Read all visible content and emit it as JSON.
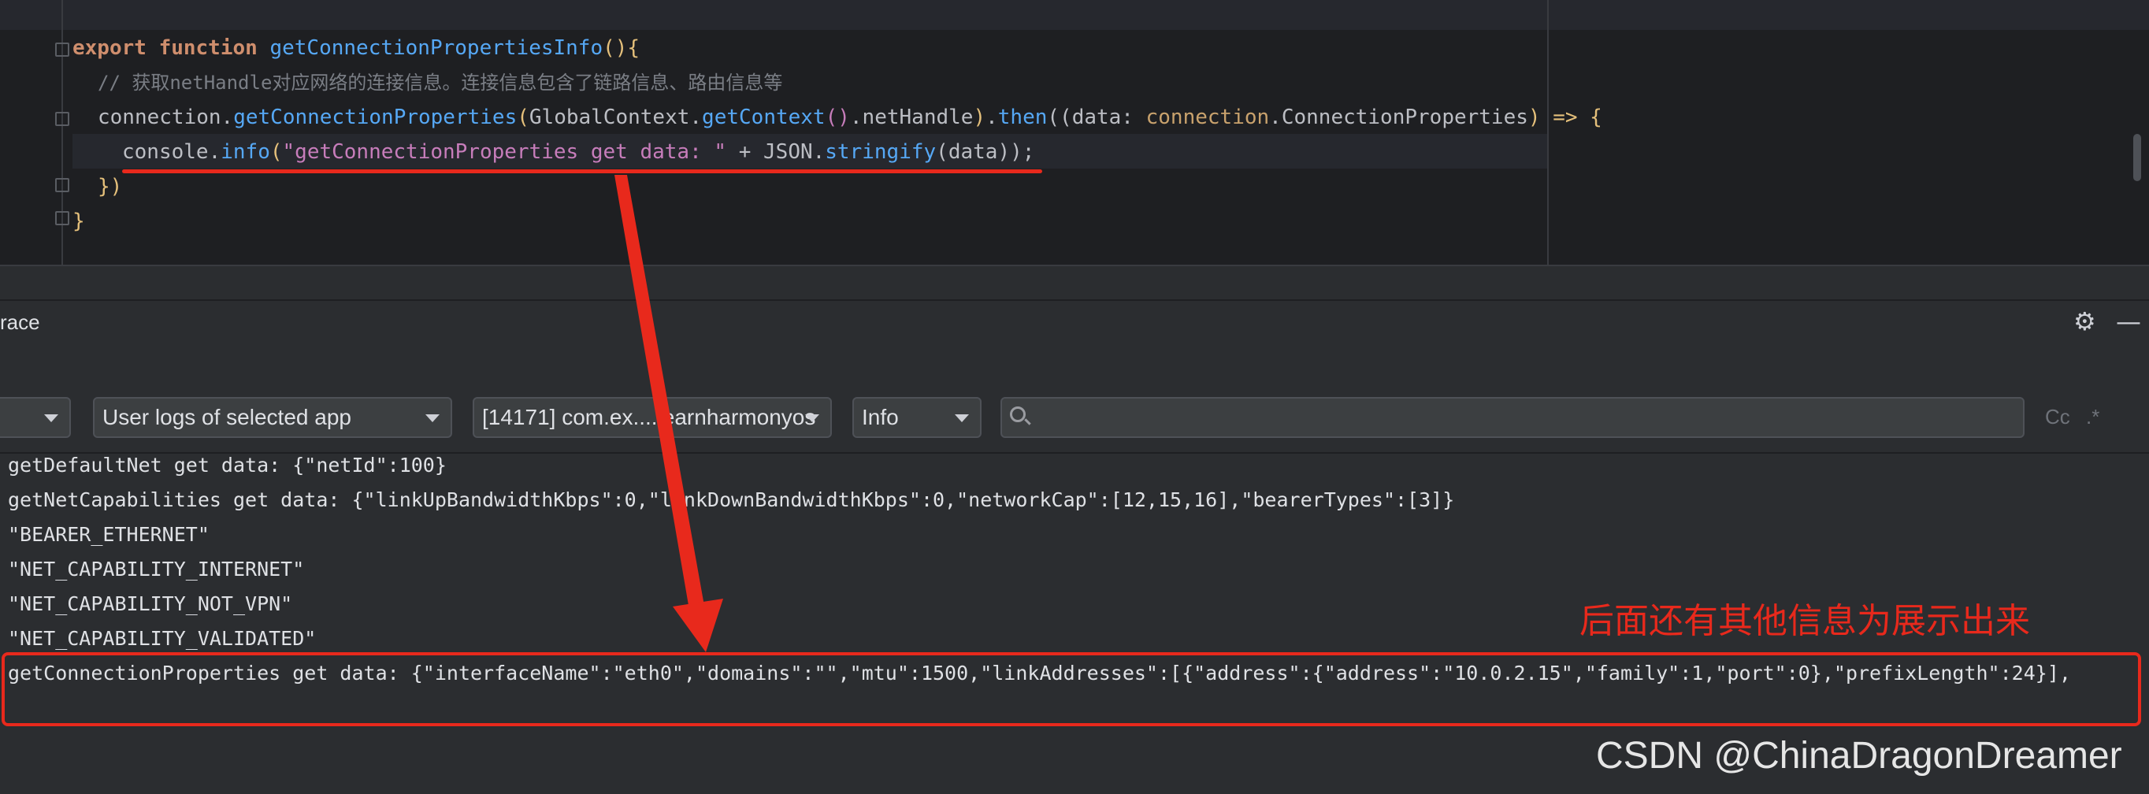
{
  "editor": {
    "line1": {
      "keyword": "export function",
      "name": "getConnectionPropertiesInfo",
      "rest": "(){"
    },
    "line2": {
      "comment": "// 获取netHandle对应网络的连接信息。连接信息包含了链路信息、路由信息等"
    },
    "line3": {
      "obj": "connection",
      "dot1": ".",
      "method": "getConnectionProperties",
      "open": "(",
      "ctx": "GlobalContext",
      "dot2": ".",
      "getctx": "getContext",
      "parens": "()",
      "nh": ".netHandle",
      "close": ")",
      "dot3": ".",
      "then": "then",
      "arg_open": "((data: ",
      "type_ns": "connection",
      "type_name": ".ConnectionProperties",
      "arrow_rest": ") => {"
    },
    "line4": {
      "console": "console",
      "dot": ".",
      "info": "info",
      "open": "(",
      "str": "\"getConnectionProperties get data: \"",
      "plus": " + JSON.",
      "stringify": "stringify",
      "end": "(data));"
    },
    "line5": "})",
    "line6": "}"
  },
  "panel": {
    "title": "race",
    "settings_icon": "gear-icon",
    "minimize_icon": "minus-icon"
  },
  "filters": {
    "device": "",
    "log_scope": "User logs of selected app",
    "process": "[14171] com.ex....learnharmonyos",
    "level": "Info",
    "search_placeholder": "",
    "case_toggle": "Cc",
    "regex_toggle": ".*"
  },
  "logs": [
    "getDefaultNet get data: {\"netId\":100}",
    "getNetCapabilities get data: {\"linkUpBandwidthKbps\":0,\"linkDownBandwidthKbps\":0,\"networkCap\":[12,15,16],\"bearerTypes\":[3]}",
    "\"BEARER_ETHERNET\"",
    "\"NET_CAPABILITY_INTERNET\"",
    "\"NET_CAPABILITY_NOT_VPN\"",
    "\"NET_CAPABILITY_VALIDATED\"",
    "getConnectionProperties get data: {\"interfaceName\":\"eth0\",\"domains\":\"\",\"mtu\":1500,\"linkAddresses\":[{\"address\":{\"address\":\"10.0.2.15\",\"family\":1,\"port\":0},\"prefixLength\":24}],"
  ],
  "annotation": {
    "note": "后面还有其他信息为展示出来",
    "color": "#e8291c"
  },
  "watermark": "CSDN @ChinaDragonDreamer"
}
